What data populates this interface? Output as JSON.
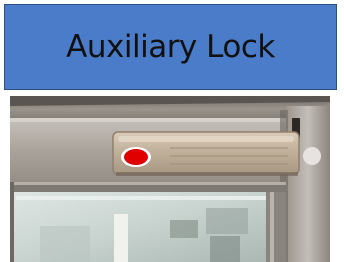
{
  "slide": {
    "title": "Auxiliary Lock"
  },
  "photo": {
    "subject": "auxiliary-lock-on-door-frame",
    "marker_color": "#e10000",
    "colors": {
      "title_bg": "#4a7cc9",
      "frame_metal": "#b3aca5",
      "lock_plate": "#c8b9a6"
    }
  }
}
